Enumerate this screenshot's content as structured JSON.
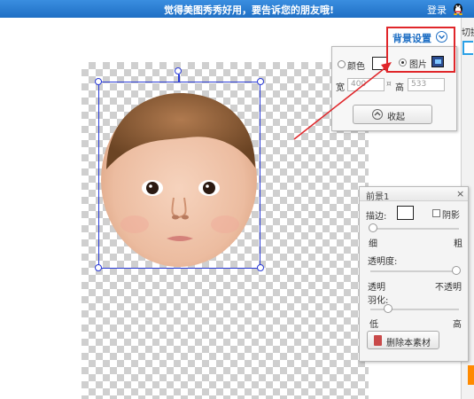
{
  "topbar": {
    "message": "觉得美图秀秀好用，要告诉您的朋友哦!",
    "login": "登录"
  },
  "right_strip": {
    "label": "切换"
  },
  "background_settings": {
    "title": "背景设置",
    "option_color": "颜色",
    "option_image": "图片",
    "selected": "图片",
    "width_label": "宽",
    "width_value": "400",
    "height_label": "高",
    "height_value": "533",
    "link_symbol": "¤",
    "collapse_label": "收起"
  },
  "foreground_panel": {
    "title": "前景1",
    "close": "×",
    "stroke_label": "描边:",
    "shadow_label": "阴影",
    "thin_label": "细",
    "thick_label": "粗",
    "opacity_label": "透明度:",
    "transparent_label": "透明",
    "opaque_label": "不透明",
    "feather_label": "羽化:",
    "low_label": "低",
    "high_label": "高",
    "delete_label": "删除本素材",
    "stroke_level": 0.0,
    "opacity_level": 1.0,
    "feather_level": 0.2
  },
  "colors": {
    "accent": "#1f6fc4",
    "highlight": "#e0262a",
    "selection": "#2a3bd6"
  }
}
